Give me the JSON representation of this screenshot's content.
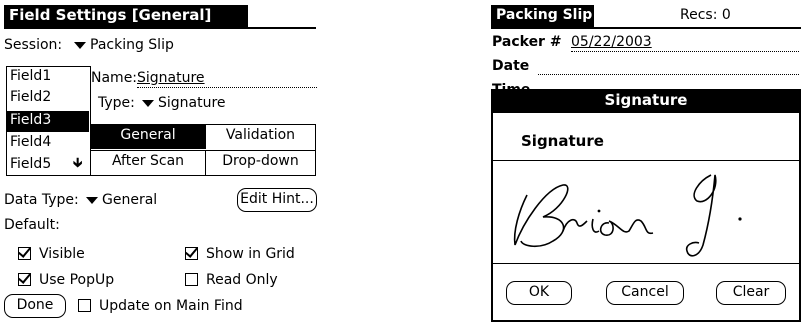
{
  "left": {
    "title": "Field Settings [General]",
    "session_label": "Session:",
    "session_value": "Packing Slip",
    "fields": [
      "Field1",
      "Field2",
      "Field3",
      "Field4",
      "Field5"
    ],
    "selected_field": "Field3",
    "name_label": "Name:",
    "name_value": "Signature",
    "type_label": "Type:",
    "type_value": "Signature",
    "tabs": [
      "General",
      "Validation",
      "After Scan",
      "Drop-down"
    ],
    "data_type_label": "Data Type:",
    "data_type_value": "General",
    "edit_hint_label": "Edit Hint...",
    "default_label": "Default:",
    "checkboxes": [
      {
        "label": "Visible",
        "checked": true
      },
      {
        "label": "Show in Grid",
        "checked": true
      },
      {
        "label": "Use PopUp",
        "checked": true
      },
      {
        "label": "Read Only",
        "checked": false
      },
      {
        "label": "Update on Main Find",
        "checked": false
      }
    ],
    "done_label": "Done"
  },
  "right": {
    "tab_title": "Packing Slip",
    "recs": "Recs: 0",
    "packer_label": "Packer #",
    "packer_value": "05/22/2003",
    "date_label": "Date",
    "time_label": "Time",
    "dialog_title": "Signature",
    "dialog_field_label": "Signature",
    "ok_label": "OK",
    "cancel_label": "Cancel",
    "clear_label": "Clear"
  }
}
